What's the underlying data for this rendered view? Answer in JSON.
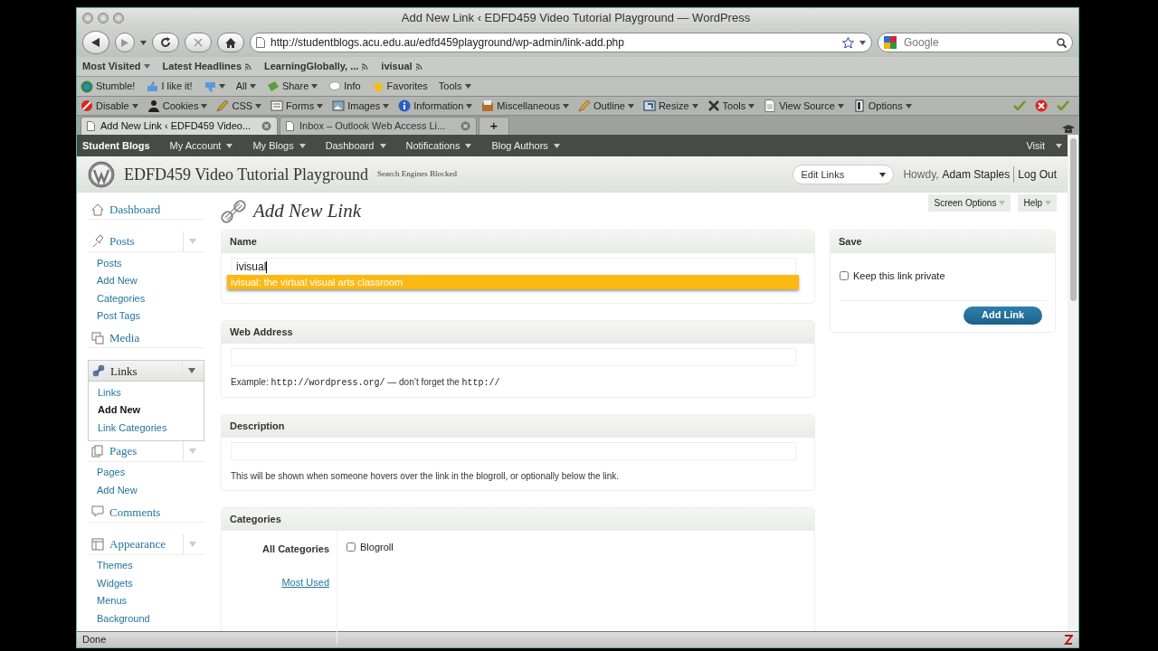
{
  "window": {
    "title": "Add New Link ‹ EDFD459 Video Tutorial Playground — WordPress"
  },
  "address_bar": {
    "url": "http://studentblogs.acu.edu.au/edfd459playground/wp-admin/link-add.php"
  },
  "search": {
    "placeholder": "Google"
  },
  "bookmarks": [
    {
      "label": "Most Visited",
      "kind": "menu"
    },
    {
      "label": "Latest Headlines",
      "kind": "feed"
    },
    {
      "label": "LearningGlobally, ...",
      "kind": "feed"
    },
    {
      "label": "ivisual",
      "kind": "feed"
    }
  ],
  "stumble_toolbar": [
    {
      "label": "Stumble!",
      "caret": false
    },
    {
      "label": "I like it!",
      "caret": false
    },
    {
      "caret": true
    },
    {
      "label": "All",
      "caret": true
    },
    {
      "label": "Share",
      "caret": true
    },
    {
      "label": "Info",
      "caret": false
    },
    {
      "label": "Favorites",
      "caret": false
    },
    {
      "label": "Tools",
      "caret": true
    }
  ],
  "developer_toolbar": [
    "Disable",
    "Cookies",
    "CSS",
    "Forms",
    "Images",
    "Information",
    "Miscellaneous",
    "Outline",
    "Resize",
    "Tools",
    "View Source",
    "Options"
  ],
  "tabs": [
    {
      "label": "Add New Link ‹ EDFD459 Video...",
      "selected": true
    },
    {
      "label": "Inbox – Outlook Web Access Li...",
      "selected": false
    }
  ],
  "new_tab": "+",
  "admin_bar": {
    "brand": "Student Blogs",
    "menus": [
      "My Account",
      "My Blogs",
      "Dashboard",
      "Notifications",
      "Blog Authors"
    ],
    "right": "Visit"
  },
  "header": {
    "site_title": "EDFD459 Video Tutorial Playground",
    "notice": "Search Engines Blocked",
    "action_menu": "Edit Links",
    "greeting": "Howdy,",
    "user": "Adam Staples",
    "logout": "Log Out"
  },
  "screen_tabs": [
    "Screen Options",
    "Help"
  ],
  "sidebar": [
    {
      "label": "Dashboard",
      "selected": false
    },
    {
      "label": "Posts",
      "expanded": true,
      "selected": false,
      "children": [
        {
          "label": "Posts",
          "selected": false
        },
        {
          "label": "Add New",
          "selected": false
        },
        {
          "label": "Categories",
          "selected": false
        },
        {
          "label": "Post Tags",
          "selected": false
        }
      ]
    },
    {
      "label": "Media",
      "selected": false
    },
    {
      "label": "Links",
      "expanded": true,
      "selected": true,
      "children": [
        {
          "label": "Links",
          "selected": false
        },
        {
          "label": "Add New",
          "selected": true
        },
        {
          "label": "Link Categories",
          "selected": false
        }
      ]
    },
    {
      "label": "Pages",
      "expanded": true,
      "selected": false,
      "children": [
        {
          "label": "Pages",
          "selected": false
        },
        {
          "label": "Add New",
          "selected": false
        }
      ]
    },
    {
      "label": "Comments",
      "selected": false
    },
    {
      "label": "Appearance",
      "expanded": true,
      "selected": false,
      "children": [
        {
          "label": "Themes",
          "selected": false
        },
        {
          "label": "Widgets",
          "selected": false
        },
        {
          "label": "Menus",
          "selected": false
        },
        {
          "label": "Background",
          "selected": false
        }
      ]
    }
  ],
  "page_title": "Add New Link",
  "name_box": {
    "heading": "Name",
    "value": "ivisual",
    "suggestion": "ivisual: the virtual visual arts classroom"
  },
  "web_address_box": {
    "heading": "Web Address",
    "example": [
      {
        "text": "Example: ",
        "kind": "text"
      },
      {
        "text": "http://wordpress.org/",
        "kind": "code"
      },
      {
        "text": " — don’t forget the ",
        "kind": "text"
      },
      {
        "text": "http://",
        "kind": "code"
      }
    ]
  },
  "description_box": {
    "heading": "Description",
    "hint": "This will be shown when someone hovers over the link in the blogroll, or optionally below the link."
  },
  "categories_box": {
    "heading": "Categories",
    "tabs": [
      {
        "label": "All Categories",
        "selected": true
      },
      {
        "label": "Most Used",
        "selected": false
      }
    ],
    "options": [
      {
        "label": "Blogroll",
        "checked": false
      }
    ]
  },
  "save_box": {
    "heading": "Save",
    "private": {
      "label": "Keep this link private",
      "checked": false
    },
    "button": "Add Link"
  },
  "status_bar": {
    "text": "Done"
  }
}
